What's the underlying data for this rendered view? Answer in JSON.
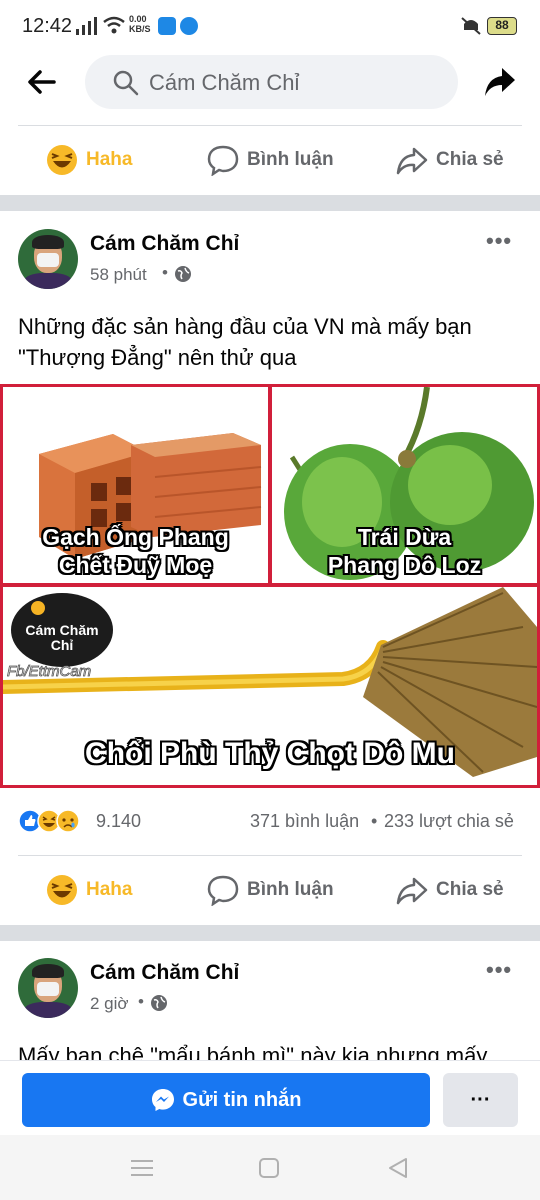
{
  "status": {
    "time": "12:42",
    "speed": "0.00\nKB/S",
    "battery": "88"
  },
  "topbar": {
    "search_placeholder": "Cám Chăm Chỉ"
  },
  "actions": {
    "haha": "Haha",
    "comment": "Bình luận",
    "share": "Chia sẻ"
  },
  "post1": {
    "author": "Cám Chăm Chỉ",
    "time": "58 phút",
    "text": "Những đặc sản hàng đầu của VN mà mấy bạn \"Thượng Đẳng\" nên thử qua",
    "image": {
      "cap1": "Gạch Ống Phang\nChết Đuỹ Moẹ",
      "cap2": "Trái Dừa\nPhang Dô Loz",
      "cap3": "Chổi Phù Thỷ Chọt Dô Mu",
      "logo": "Cám Chăm\nChỉ",
      "watermark": "Fb/EttmCam"
    },
    "reactions_count": "9.140",
    "comments": "371 bình luận",
    "shares": "233 lượt chia sẻ"
  },
  "post2": {
    "author": "Cám Chăm Chỉ",
    "time": "2 giờ",
    "text": "Mấy bạn chê \"mẩu bánh mì\" này kia nhưng mấy"
  },
  "bottom": {
    "message_button": "Gửi tin nhắn",
    "more_button": "···"
  }
}
